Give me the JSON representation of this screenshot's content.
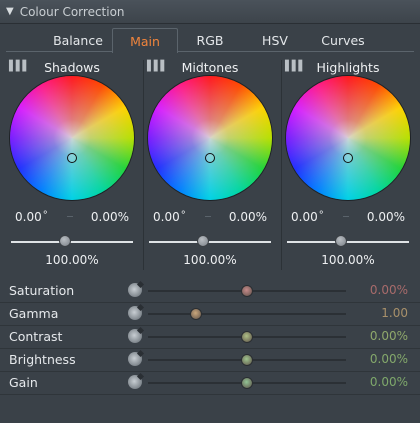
{
  "panel": {
    "title": "Colour Correction"
  },
  "tabs": [
    {
      "label": "Balance",
      "active": false
    },
    {
      "label": "Main",
      "active": true
    },
    {
      "label": "RGB",
      "active": false
    },
    {
      "label": "HSV",
      "active": false
    },
    {
      "label": "Curves",
      "active": false
    }
  ],
  "wheels": [
    {
      "title": "Shadows",
      "angle": "0.00",
      "magnitude": "0.00%",
      "level": "100.00%"
    },
    {
      "title": "Midtones",
      "angle": "0.00",
      "magnitude": "0.00%",
      "level": "100.00%"
    },
    {
      "title": "Highlights",
      "angle": "0.00",
      "magnitude": "0.00%",
      "level": "100.00%"
    }
  ],
  "sliders": [
    {
      "label": "Saturation",
      "value": "0.00%",
      "fraction": 0.5,
      "thumb_color": "#c58a8a",
      "value_color": "#a86b6b"
    },
    {
      "label": "Gamma",
      "value": "1.00",
      "fraction": 0.24,
      "thumb_color": "#caa77c",
      "value_color": "#a8906a"
    },
    {
      "label": "Contrast",
      "value": "0.00%",
      "fraction": 0.5,
      "thumb_color": "#aebf86",
      "value_color": "#8fa86b"
    },
    {
      "label": "Brightness",
      "value": "0.00%",
      "fraction": 0.5,
      "thumb_color": "#9fc48e",
      "value_color": "#84a86b"
    },
    {
      "label": "Gain",
      "value": "0.00%",
      "fraction": 0.5,
      "thumb_color": "#93c495",
      "value_color": "#7ea86b"
    }
  ],
  "icons": {
    "collapse": "triangle-down-icon",
    "histogram": "histogram-icon",
    "reset": "reset-knob-icon"
  },
  "colors": {
    "active_tab": "#f0843c"
  }
}
